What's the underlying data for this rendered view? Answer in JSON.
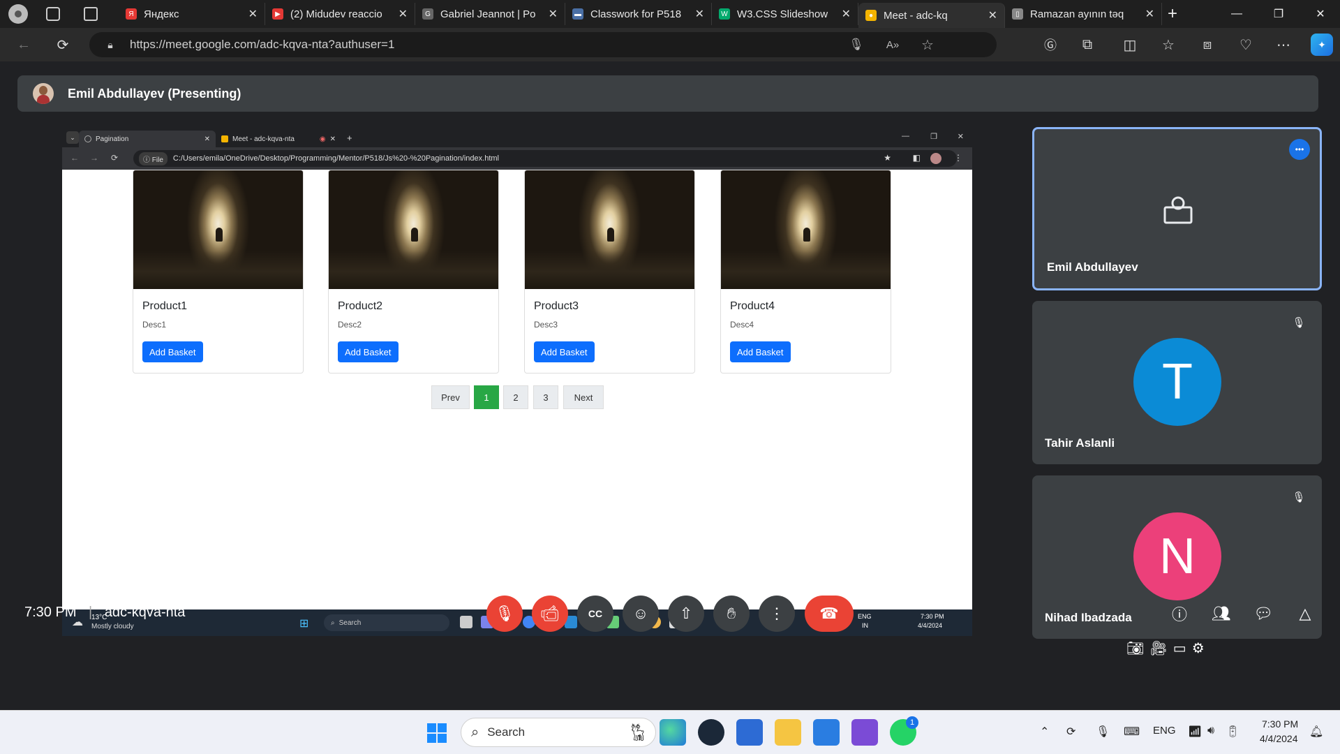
{
  "browser": {
    "tabs": [
      {
        "title": "Яндекс",
        "fav_color": "#e53935",
        "fav_text": "Я"
      },
      {
        "title": "(2) Midudev reaccio",
        "fav_color": "#e53935",
        "fav_text": "▶"
      },
      {
        "title": "Gabriel Jeannot | Po",
        "fav_color": "#666",
        "fav_text": "G"
      },
      {
        "title": "Classwork for P518",
        "fav_color": "#4a6fa5",
        "fav_text": "▬"
      },
      {
        "title": "W3.CSS Slideshow",
        "fav_color": "#04aa6d",
        "fav_text": "W"
      },
      {
        "title": "Meet - adc-kq",
        "fav_color": "#f4b400",
        "fav_text": "●"
      },
      {
        "title": "Ramazan ayının təq",
        "fav_color": "#888",
        "fav_text": "▯"
      }
    ],
    "new_tab": "+",
    "url": "https://meet.google.com/adc-kqva-nta?authuser=1"
  },
  "meet": {
    "presenter_banner": "Emil Abdullayev (Presenting)",
    "time": "7:30 PM",
    "separator": "|",
    "meeting_code": "adc-kqva-nta",
    "participants": [
      {
        "name": "Emil Abdullayev",
        "initial": "",
        "color": "#3c4043",
        "presenting": true
      },
      {
        "name": "Tahir Aslanli",
        "initial": "T",
        "color": "#0b8bd6"
      },
      {
        "name": "Nihad Ibadzada",
        "initial": "N",
        "color": "#ec407a"
      }
    ],
    "more_options": "•••"
  },
  "shared": {
    "tabs": [
      {
        "title": "Pagination"
      },
      {
        "title": "Meet - adc-kqva-nta"
      }
    ],
    "file_label": "File",
    "url": "C:/Users/emila/OneDrive/Desktop/Programming/Mentor/P518/Js%20-%20Pagination/index.html",
    "products": [
      {
        "name": "Product1",
        "desc": "Desc1",
        "button": "Add Basket"
      },
      {
        "name": "Product2",
        "desc": "Desc2",
        "button": "Add Basket"
      },
      {
        "name": "Product3",
        "desc": "Desc3",
        "button": "Add Basket"
      },
      {
        "name": "Product4",
        "desc": "Desc4",
        "button": "Add Basket"
      }
    ],
    "pagination": {
      "prev": "Prev",
      "pages": [
        "1",
        "2",
        "3"
      ],
      "active": "1",
      "next": "Next"
    },
    "taskbar": {
      "temp": "13°C",
      "weather": "Mostly cloudy",
      "search": "Search",
      "lang1": "ENG",
      "lang2": "IN",
      "time": "7:30 PM",
      "date": "4/4/2024"
    }
  },
  "windows": {
    "search": "Search",
    "lang": "ENG",
    "time": "7:30 PM",
    "date": "4/4/2024",
    "whatsapp_badge": "1"
  }
}
